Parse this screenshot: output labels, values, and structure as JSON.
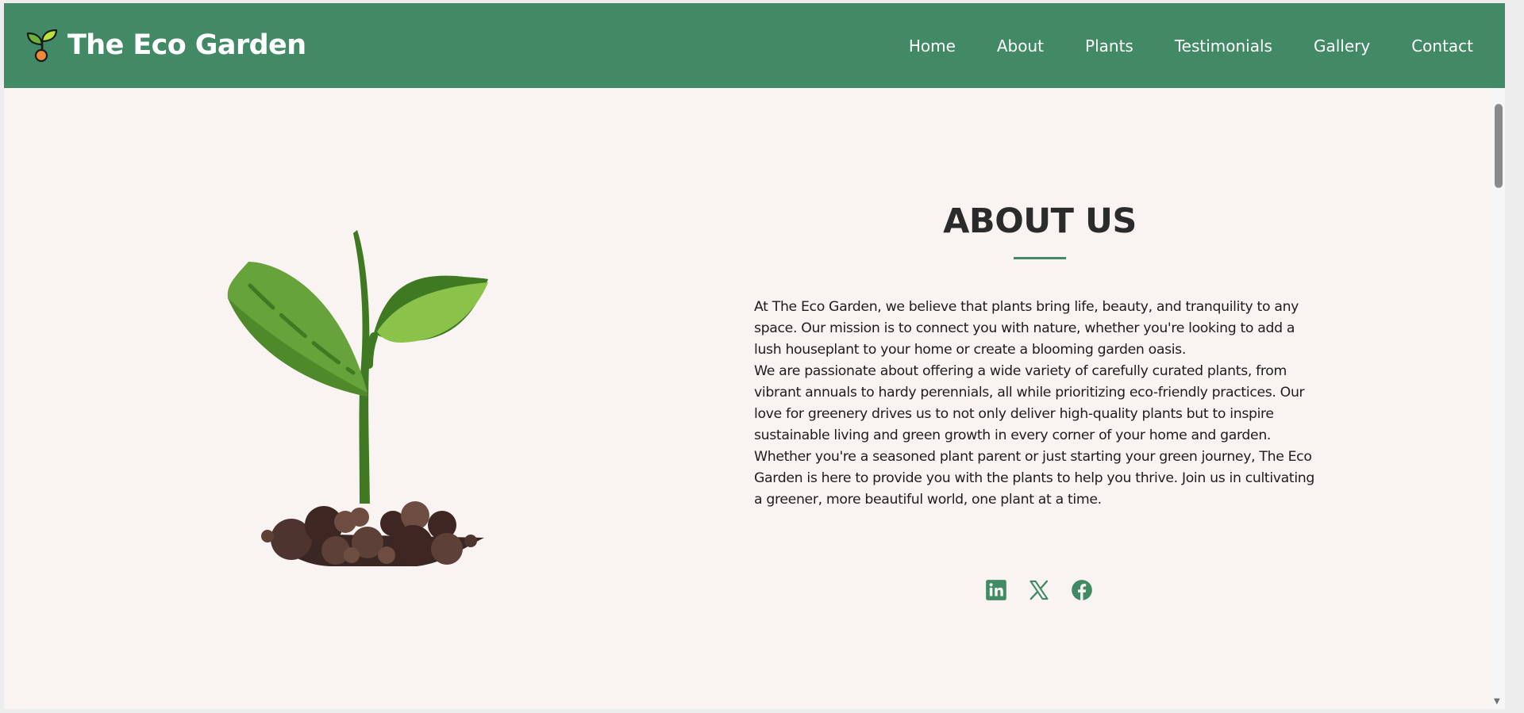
{
  "brand": {
    "name": "The Eco Garden",
    "logo_icon": "sprout-icon"
  },
  "nav": {
    "items": [
      {
        "label": "Home"
      },
      {
        "label": "About"
      },
      {
        "label": "Plants"
      },
      {
        "label": "Testimonials"
      },
      {
        "label": "Gallery"
      },
      {
        "label": "Contact"
      }
    ]
  },
  "about": {
    "title": "ABOUT US",
    "paragraphs": [
      "At The Eco Garden, we believe that plants bring life, beauty, and tranquility to any space. Our mission is to connect you with nature, whether you're looking to add a lush houseplant to your home or create a blooming garden oasis.",
      "We are passionate about offering a wide variety of carefully curated plants, from vibrant annuals to hardy perennials, all while prioritizing eco-friendly practices. Our love for greenery drives us to not only deliver high-quality plants but to inspire sustainable living and green growth in every corner of your home and garden.",
      "Whether you're a seasoned plant parent or just starting your green journey, The Eco Garden is here to provide you with the plants to help you thrive. Join us in cultivating a greener, more beautiful world, one plant at a time."
    ]
  },
  "socials": [
    {
      "icon": "linkedin-icon"
    },
    {
      "icon": "x-twitter-icon"
    },
    {
      "icon": "facebook-icon"
    }
  ],
  "colors": {
    "primary": "#418a65",
    "background": "#f9f3f2",
    "heading": "#2c2b2b",
    "text": "#1e1e1e"
  }
}
